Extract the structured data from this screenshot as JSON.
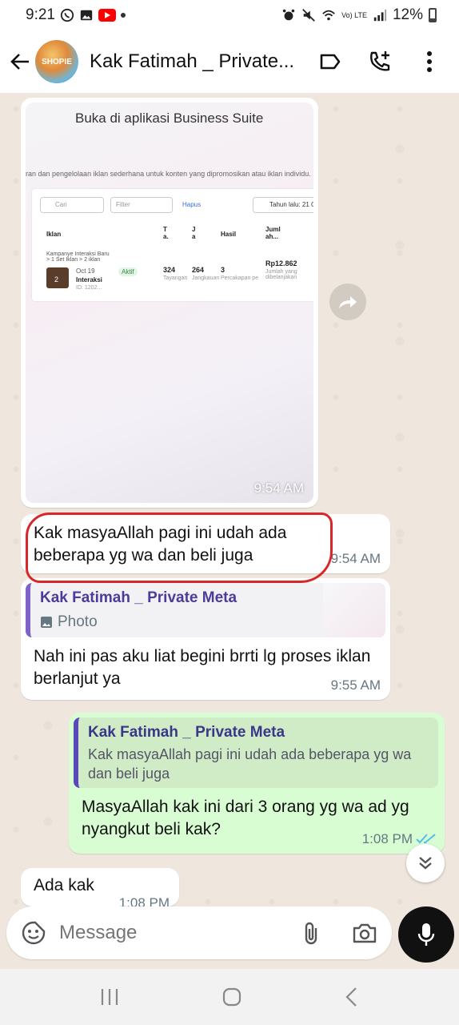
{
  "status_bar": {
    "time": "9:21",
    "battery": "12%",
    "network": "Vo) LTE"
  },
  "header": {
    "title": "Kak Fatimah _ Private...",
    "avatar_text": "SHOPIE"
  },
  "messages": {
    "image_msg": {
      "title": "Buka di aplikasi Business Suite",
      "subtitle": "ran dan pengelolaan iklan sederhana untuk konten yang dipromosikan atau iklan individu.",
      "search_placeholder": "Cari",
      "filter_label": "Filter",
      "hapus": "Hapus",
      "date_label": "Tahun lalu: 21 O",
      "col_iklan": "Iklan",
      "col_t": "T a.",
      "col_j": "J a",
      "col_hasil": "Hasil",
      "col_jumlah": "Juml ah...",
      "row_campaign": "Kampanye Interaksi Baru > 1 Set Iklan > 2 iklan",
      "row_date": "Oct 19",
      "row_name": "Interaksi",
      "row_id": "ID: 1202...",
      "row_status": "Aktif",
      "row_t": "324",
      "row_t_label": "Tayangan",
      "row_j": "264",
      "row_j_label": "Jangkauan",
      "row_hasil": "3",
      "row_hasil_label": "Percakapan pe",
      "row_jumlah": "Rp12.862",
      "row_jumlah_label": "Jumlah yang dibelanjakan",
      "time": "9:54 AM"
    },
    "msg2": {
      "text": "Kak masyaAllah pagi ini udah ada beberapa yg wa dan beli juga",
      "time": "9:54 AM"
    },
    "msg3": {
      "quote_name": "Kak Fatimah _ Private Meta",
      "quote_type": "Photo",
      "text": "Nah ini pas aku liat begini brrti lg proses iklan berlanjut ya",
      "time": "9:55 AM"
    },
    "msg4": {
      "quote_name": "Kak Fatimah _ Private Meta",
      "quote_text": "Kak masyaAllah pagi ini udah ada beberapa yg wa dan beli juga",
      "text": "MasyaAllah kak ini dari 3 orang yg wa ad yg nyangkut beli kak?",
      "time": "1:08 PM"
    },
    "msg5": {
      "text": "Ada kak",
      "time": "1:08 PM"
    }
  },
  "input": {
    "placeholder": "Message"
  },
  "colors": {
    "outgoing_bubble": "#d9fdd3",
    "incoming_bubble": "#ffffff",
    "read_ticks": "#53bdeb",
    "highlight_oval": "#d9262a"
  }
}
